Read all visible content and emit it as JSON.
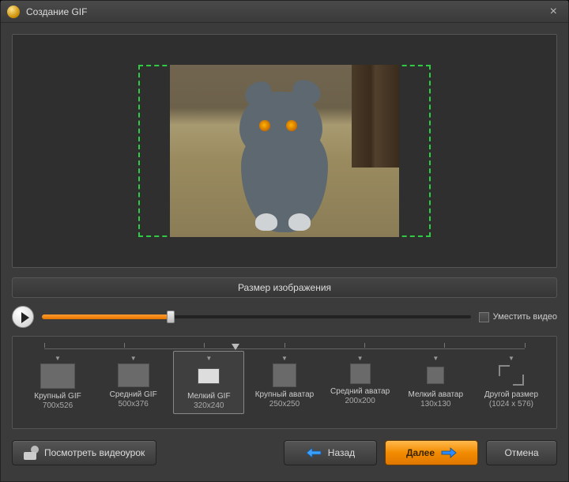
{
  "window": {
    "title": "Создание GIF"
  },
  "section_header": "Размер изображения",
  "fit_video_label": "Уместить видео",
  "slider": {
    "value_percent": 30
  },
  "presets": [
    {
      "label": "Крупный GIF",
      "dim": "700x526"
    },
    {
      "label": "Средний GIF",
      "dim": "500x376"
    },
    {
      "label": "Мелкий GIF",
      "dim": "320x240"
    },
    {
      "label": "Крупный аватар",
      "dim": "250x250"
    },
    {
      "label": "Средний аватар",
      "dim": "200x200"
    },
    {
      "label": "Мелкий аватар",
      "dim": "130x130"
    },
    {
      "label": "Другой размер",
      "dim": "(1024 x 576)"
    }
  ],
  "selected_preset_index": 2,
  "buttons": {
    "tutorial": "Посмотреть видеоурок",
    "back": "Назад",
    "next": "Далее",
    "cancel": "Отмена"
  }
}
